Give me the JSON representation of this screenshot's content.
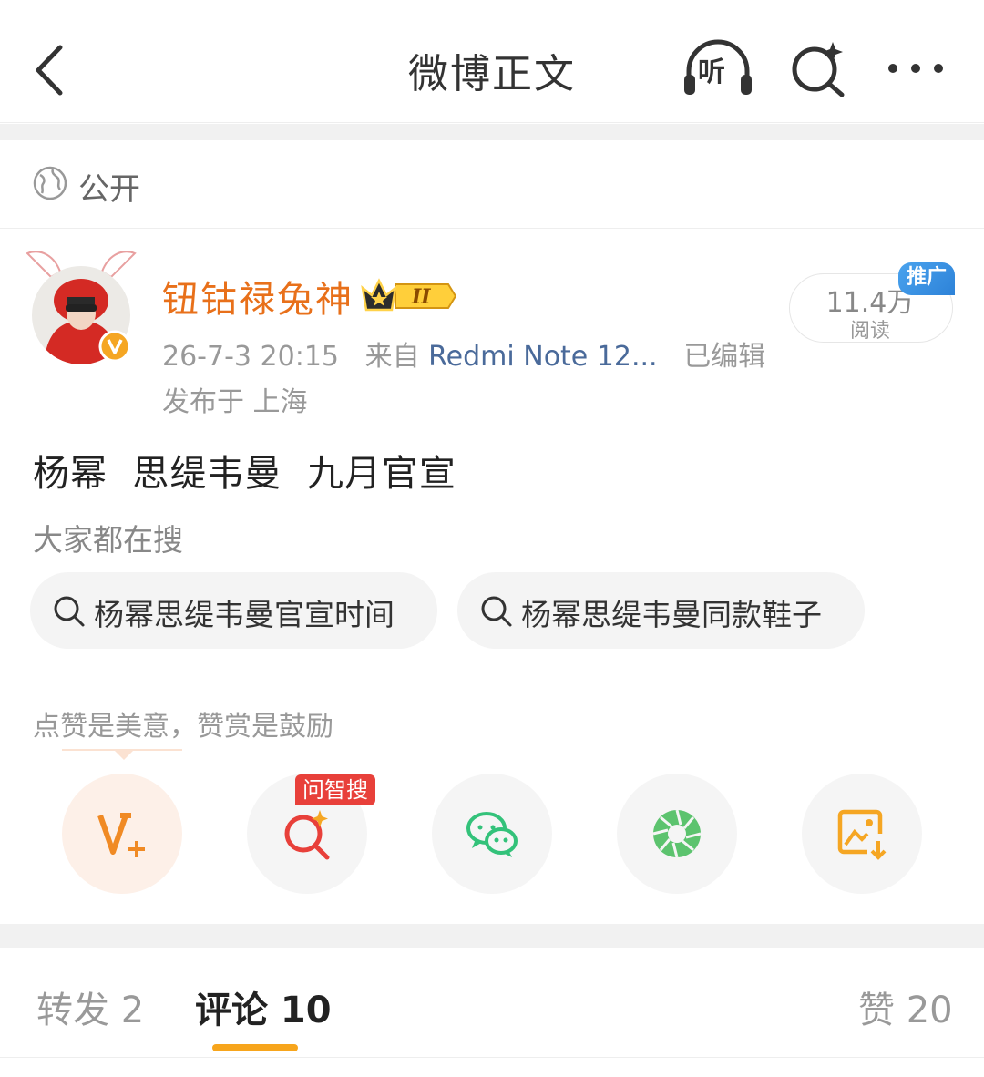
{
  "header": {
    "title": "微博正文",
    "listen_label": "听"
  },
  "visibility": {
    "label": "公开"
  },
  "post": {
    "username": "钮钴禄兔神",
    "member_level": "II",
    "time": "26-7-3 20:15",
    "from_prefix": "来自",
    "source": "Redmi Note 12...",
    "edited": "已编辑",
    "location": "发布于 上海",
    "reads_count": "11.4万",
    "reads_label": "阅读",
    "promo_badge": "推广",
    "content": "杨幂  思缇韦曼  九月官宣"
  },
  "search_section": {
    "hint": "大家都在搜",
    "chips": [
      "杨幂思缇韦曼官宣时间",
      "杨幂思缇韦曼同款鞋子"
    ]
  },
  "reward": {
    "hint": "点赞是美意，赞赏是鼓励",
    "wzs_badge": "问智搜"
  },
  "tabs": {
    "repost": "转发 2",
    "comment": "评论 10",
    "like": "赞 20"
  },
  "colors": {
    "accent_orange": "#e8701a",
    "tab_underline": "#f7a51c",
    "wechat_green": "#33c27a",
    "badge_red": "#e8403a",
    "promo_blue": "#2d82d8"
  }
}
